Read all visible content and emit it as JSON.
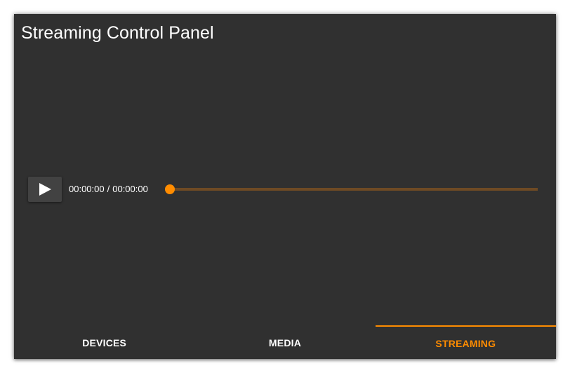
{
  "app": {
    "title": "Streaming Control Panel"
  },
  "player": {
    "current_time": "00:00:00",
    "separator": "/",
    "total_time": "00:00:00",
    "progress_fraction": 0,
    "play_icon": "play-icon"
  },
  "tabs": [
    {
      "label": "DEVICES",
      "active": false
    },
    {
      "label": "MEDIA",
      "active": false
    },
    {
      "label": "STREAMING",
      "active": true
    }
  ],
  "colors": {
    "panel_background": "#303030",
    "accent": "#ff8c00",
    "track_background": "#6e4a24",
    "button_background": "#424242",
    "text": "#ffffff"
  }
}
